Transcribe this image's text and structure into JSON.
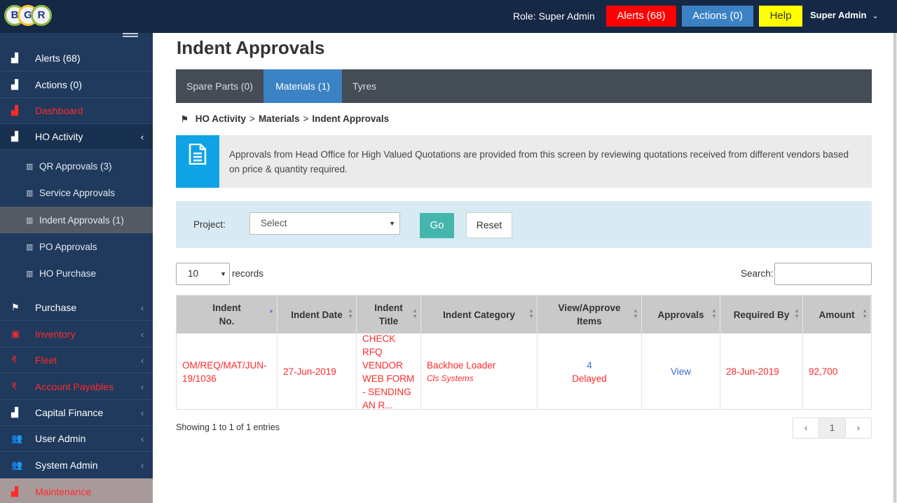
{
  "header": {
    "logo_letters": [
      "B",
      "G",
      "R"
    ],
    "role": "Role: Super Admin",
    "alerts": "Alerts (68)",
    "actions": "Actions (0)",
    "help": "Help",
    "user": "Super Admin",
    "user_caret": "⌄"
  },
  "sidebar": {
    "items": [
      {
        "label": "Alerts (68)",
        "icon": "▟",
        "arrow": ""
      },
      {
        "label": "Actions (0)",
        "icon": "▟",
        "arrow": ""
      },
      {
        "label": "Dashboard",
        "icon": "▟",
        "arrow": ""
      },
      {
        "label": "HO Activity",
        "icon": "▟",
        "arrow": "‹"
      }
    ],
    "sub_items": [
      {
        "label": "QR Approvals (3)",
        "icon": "▥"
      },
      {
        "label": "Service Approvals",
        "icon": "▥"
      },
      {
        "label": "Indent Approvals (1)",
        "icon": "▥"
      },
      {
        "label": "PO Approvals",
        "icon": "▥"
      },
      {
        "label": "HO Purchase",
        "icon": "▥"
      }
    ],
    "lower_items": [
      {
        "label": "Purchase",
        "icon": "⚑",
        "arrow": "‹"
      },
      {
        "label": "Inventory",
        "icon": "▣",
        "arrow": "‹"
      },
      {
        "label": "Fleet",
        "icon": "₹",
        "arrow": "‹"
      },
      {
        "label": "Account Payables",
        "icon": "₹",
        "arrow": "‹"
      },
      {
        "label": "Capital Finance",
        "icon": "▟",
        "arrow": "‹"
      },
      {
        "label": "User Admin",
        "icon": "👥",
        "arrow": "‹"
      },
      {
        "label": "System Admin",
        "icon": "👥",
        "arrow": "‹"
      },
      {
        "label": "Maintenance",
        "icon": "▟",
        "arrow": ""
      }
    ]
  },
  "main": {
    "title": "Indent Approvals",
    "tabs": [
      {
        "label": "Spare Parts (0)"
      },
      {
        "label": "Materials (1)"
      },
      {
        "label": "Tyres"
      }
    ],
    "breadcrumb": [
      "HO Activity",
      ">",
      "Materials",
      ">",
      "Indent Approvals"
    ],
    "info_text": "Approvals from Head Office for High Valued Quotations are provided from this screen by reviewing quotations received from different vendors based on price & quantity required.",
    "filter": {
      "project_label": "Project:",
      "project_value": "Select",
      "go": "Go",
      "reset": "Reset"
    },
    "records": {
      "value": "10",
      "label": "records"
    },
    "search_label": "Search:",
    "table": {
      "headers": [
        "Indent No.",
        "Indent Date",
        "Indent Title",
        "Indent Category",
        "View/Approve Items",
        "Approvals",
        "Required By",
        "Amount"
      ],
      "row": {
        "indent_no": "OM/REQ/MAT/JUN-19/1036",
        "indent_date": "27-Jun-2019",
        "indent_title": "CHECK RFQ VENDOR WEB FORM - SENDING AN R...",
        "category": "Backhoe Loader",
        "category_sub": "Cls Systems",
        "items_count": "4",
        "items_status": "Delayed",
        "approvals": "View",
        "required_by": "28-Jun-2019",
        "amount": "92,700"
      }
    },
    "entries_info": "Showing 1 to 1 of 1 entries",
    "pager": {
      "prev": "‹",
      "page": "1",
      "next": "›"
    }
  },
  "colors": {
    "topbar": "#152845",
    "sidebar": "#1f3a5d",
    "alerts": "#ff0000",
    "actions": "#3b82c4",
    "help": "#ffff00",
    "go": "#45b6ae",
    "info_box": "#0fa3e6",
    "row_text": "#ff2a2a"
  }
}
